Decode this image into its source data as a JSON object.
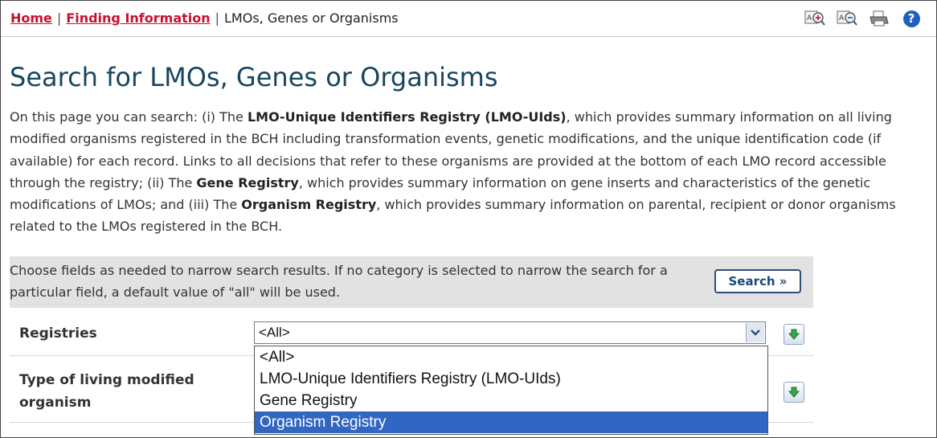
{
  "breadcrumb": {
    "home": "Home",
    "separator": "|",
    "finding": "Finding Information",
    "current": "LMOs, Genes or Organisms"
  },
  "toolbar": {
    "icons": [
      "zoom-in-text-icon",
      "zoom-out-text-icon",
      "print-icon",
      "help-icon"
    ],
    "help_glyph": "?"
  },
  "page": {
    "title": "Search for LMOs, Genes or Organisms",
    "intro": {
      "p1": "On this page you can search: (i) The ",
      "b1": "LMO-Unique Identifiers Registry (LMO-UIds)",
      "p2": ", which provides summary information on all living modified organisms registered in the BCH including transformation events, genetic modifications, and the unique identification code (if available) for each record. Links to all decisions that refer to these organisms are provided at the bottom of each LMO record accessible through the registry; (ii) The ",
      "b2": "Gene Registry",
      "p3": ", which provides summary information on gene inserts and characteristics of the genetic modifications of LMOs; and (iii) The ",
      "b3": "Organism Registry",
      "p4": ", which provides summary information on parental, recipient or donor organisms related to the LMOs registered in the BCH."
    }
  },
  "search_panel": {
    "instructions": "Choose fields as needed to narrow search results. If no category is selected to narrow the search for a particular field, a default value of \"all\" will be used.",
    "search_button": "Search »"
  },
  "fields": {
    "registries": {
      "label": "Registries",
      "selected": "<All>",
      "options": [
        "<All>",
        "LMO-Unique Identifiers Registry (LMO-UIds)",
        "Gene Registry",
        "Organism Registry"
      ],
      "highlighted_option": "Organism Registry"
    },
    "type_of_lmo": {
      "label": "Type of living modified organism"
    }
  },
  "colors": {
    "link_red": "#c8102e",
    "title_blue": "#17465f",
    "panel_gray": "#e2e2e2",
    "highlight_blue": "#3166c3"
  }
}
